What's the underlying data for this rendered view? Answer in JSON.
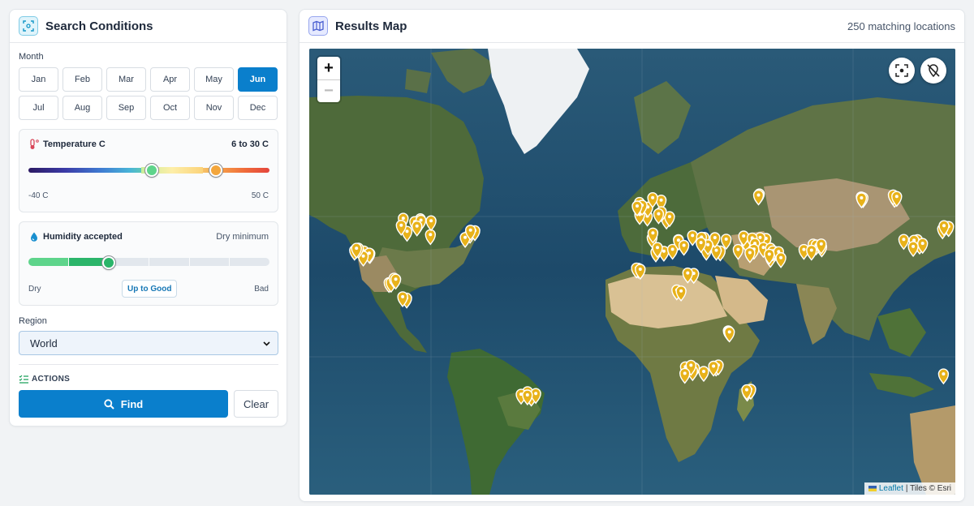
{
  "search": {
    "title": "Search Conditions",
    "month_label": "Month",
    "months": [
      {
        "label": "Jan",
        "active": false
      },
      {
        "label": "Feb",
        "active": false
      },
      {
        "label": "Mar",
        "active": false
      },
      {
        "label": "Apr",
        "active": false
      },
      {
        "label": "May",
        "active": false
      },
      {
        "label": "Jun",
        "active": true
      },
      {
        "label": "Jul",
        "active": false
      },
      {
        "label": "Aug",
        "active": false
      },
      {
        "label": "Sep",
        "active": false
      },
      {
        "label": "Oct",
        "active": false
      },
      {
        "label": "Nov",
        "active": false
      },
      {
        "label": "Dec",
        "active": false
      }
    ],
    "temperature": {
      "title": "Temperature C",
      "value": "6 to 30 C",
      "min_label": "-40 C",
      "max_label": "50 C",
      "scale_min": -40,
      "scale_max": 50,
      "selected_min": 6,
      "selected_max": 30
    },
    "humidity": {
      "title": "Humidity accepted",
      "value": "Dry minimum",
      "left_label": "Dry",
      "right_label": "Bad",
      "level_pill": "Up to Good",
      "level": 2,
      "levels": 6
    },
    "region": {
      "label": "Region",
      "selected": "World"
    },
    "actions": {
      "label": "ACTIONS",
      "find": "Find",
      "clear": "Clear"
    }
  },
  "results": {
    "title": "Results Map",
    "count_text": "250 matching locations",
    "zoom_in": "+",
    "zoom_out": "−",
    "attribution_link": "Leaflet",
    "attribution_text": "| Tiles © Esri"
  },
  "colors": {
    "accent": "#0a7fcc",
    "marker": "#e8b21a",
    "good_green": "#2bb56a"
  }
}
